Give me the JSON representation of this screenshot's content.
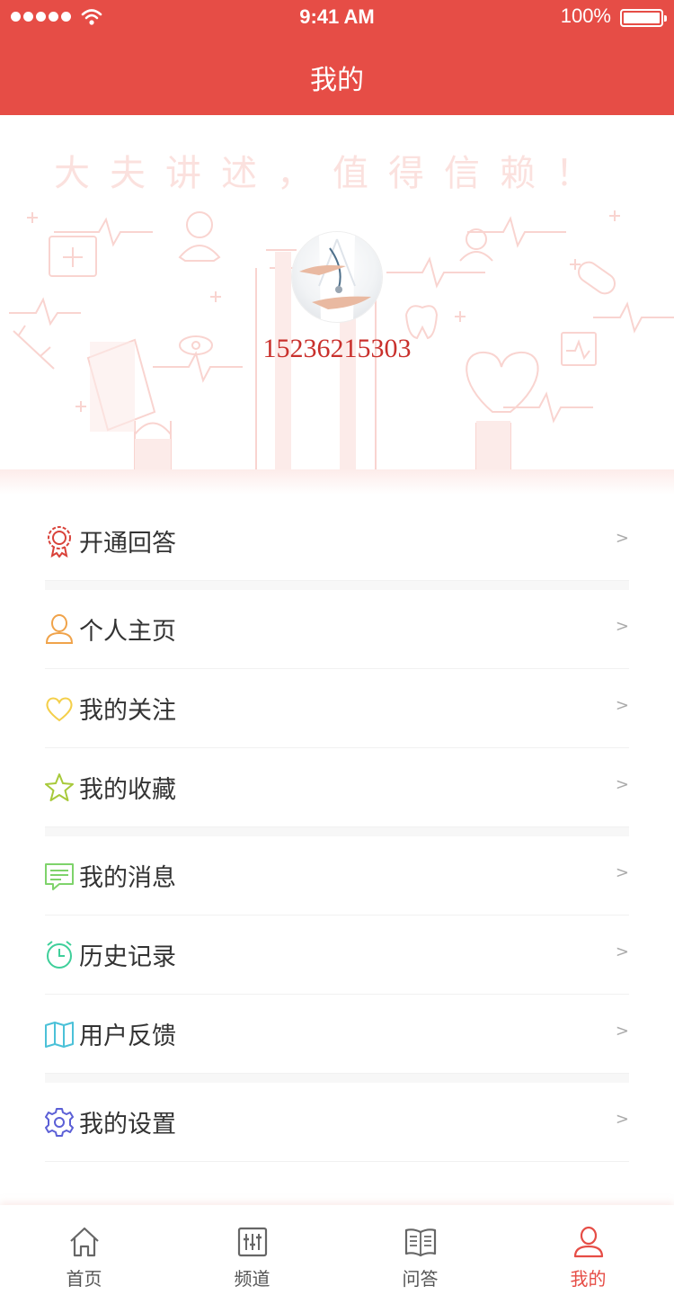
{
  "status_bar": {
    "time": "9:41 AM",
    "battery": "100%"
  },
  "nav": {
    "title": "我的"
  },
  "hero": {
    "slogan": "大夫讲述，值得信赖！",
    "phone": "15236215303"
  },
  "menu": {
    "items": [
      {
        "label": "开通回答",
        "icon": "award-icon",
        "color": "#d9423a",
        "arrow": ">"
      },
      {
        "label": "个人主页",
        "icon": "person-icon",
        "color": "#f0a34a",
        "arrow": ">"
      },
      {
        "label": "我的关注",
        "icon": "heart-icon",
        "color": "#f4cf4a",
        "arrow": ">"
      },
      {
        "label": "我的收藏",
        "icon": "star-icon",
        "color": "#a7c93a",
        "arrow": ">"
      },
      {
        "label": "我的消息",
        "icon": "message-icon",
        "color": "#7ed36b",
        "arrow": ">"
      },
      {
        "label": "历史记录",
        "icon": "alarm-clock-icon",
        "color": "#3ecf9a",
        "arrow": ">"
      },
      {
        "label": "用户反馈",
        "icon": "map-icon",
        "color": "#4bc1d8",
        "arrow": ">"
      },
      {
        "label": "我的设置",
        "icon": "gear-icon",
        "color": "#5b5fd6",
        "arrow": ">"
      }
    ]
  },
  "tabbar": {
    "tabs": [
      {
        "label": "首页",
        "icon": "home-icon",
        "active": false
      },
      {
        "label": "频道",
        "icon": "sliders-icon",
        "active": false
      },
      {
        "label": "问答",
        "icon": "book-icon",
        "active": false
      },
      {
        "label": "我的",
        "icon": "user-icon",
        "active": true
      }
    ]
  },
  "colors": {
    "brand": "#e64d46",
    "phone": "#c9302c",
    "active_tab": "#e64d46"
  }
}
